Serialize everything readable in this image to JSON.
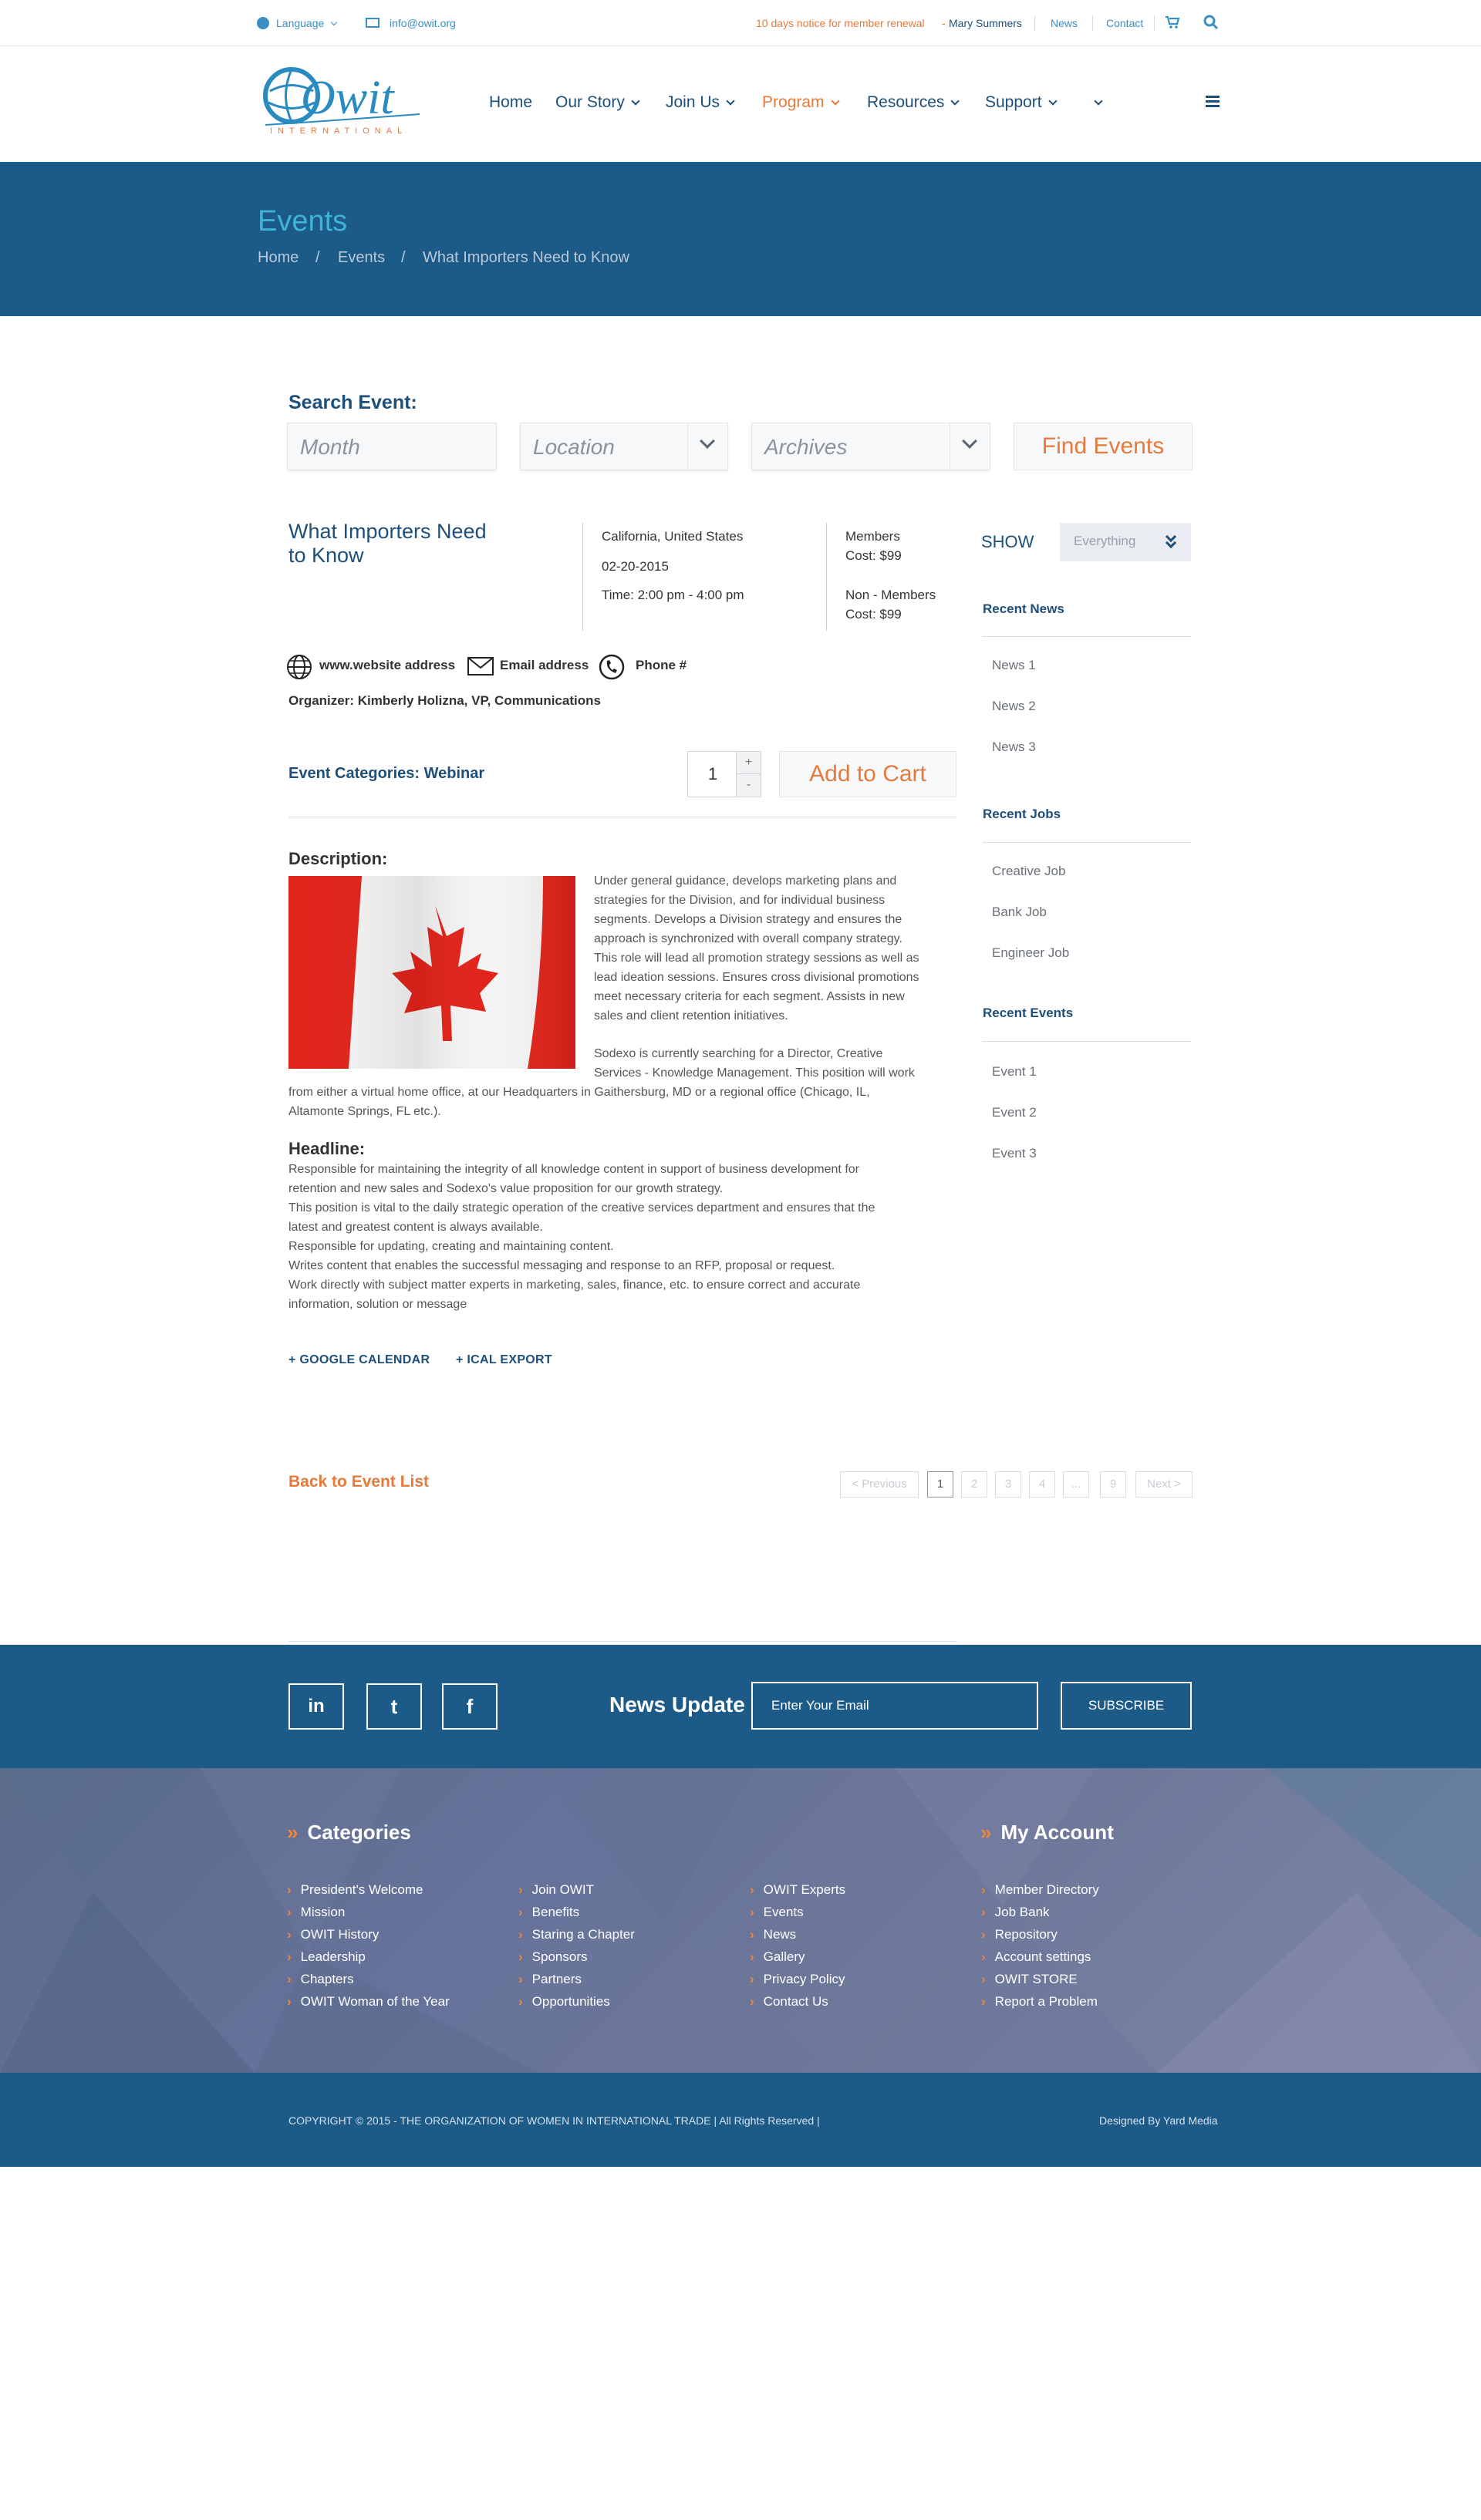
{
  "topbar": {
    "language": "Language",
    "email": "info@owit.org",
    "notice": "10 days notice for member renewal",
    "dash": "-",
    "user": "Mary Summers",
    "news": "News",
    "contact": "Contact"
  },
  "logo": {
    "word": "Owit",
    "sub": "INTERNATIONAL"
  },
  "nav": [
    {
      "label": "Home"
    },
    {
      "label": "Our Story"
    },
    {
      "label": "Join Us"
    },
    {
      "label": "Program"
    },
    {
      "label": "Resources"
    },
    {
      "label": "Support"
    }
  ],
  "banner": {
    "title": "Events",
    "crumbs": [
      "Home",
      "Events",
      "What Importers Need to Know"
    ],
    "sep": "/"
  },
  "search": {
    "title": "Search Event:",
    "month_placeholder": "Month",
    "location_placeholder": "Location",
    "archives_placeholder": "Archives",
    "button": "Find Events"
  },
  "event": {
    "title": "What Importers Need to Know",
    "location": "California, United States",
    "date": "02-20-2015",
    "time": "Time: 2:00 pm - 4:00 pm",
    "members_label": "Members",
    "members_cost": "Cost: $99",
    "nonmembers_label": "Non - Members",
    "nonmembers_cost": "Cost: $99",
    "website": "www.website address",
    "email": "Email address",
    "phone": "Phone #",
    "organizer": "Organizer: Kimberly Holizna, VP, Communications",
    "categories": "Event Categories: Webinar",
    "quantity": "1",
    "qty_up": "+",
    "qty_down": "-",
    "cart_button": "Add to Cart"
  },
  "description": {
    "heading": "Description:",
    "p1_lines": [
      "Under general guidance, develops marketing plans and",
      "strategies for the Division, and for individual business",
      "segments. Develops a Division strategy and ensures the",
      "approach is synchronized with overall company strategy.",
      "This role will lead all promotion strategy sessions as well as",
      "lead ideation sessions. Ensures cross divisional promotions",
      "meet necessary criteria for each segment. Assists in new",
      "sales and client retention initiatives."
    ],
    "p2_lines_right": [
      "Sodexo is currently searching for a Director, Creative",
      "Services - Knowledge Management. This position will work"
    ],
    "p2_lines_full": [
      "from either a virtual home office, at our Headquarters in Gaithersburg, MD or a regional office (Chicago, IL,",
      "Altamonte Springs, FL etc.)."
    ]
  },
  "headline": {
    "heading": "Headline:",
    "lines": [
      "Responsible for maintaining the integrity of all knowledge content in support of business development for",
      "retention and new sales and Sodexo's value proposition for our growth strategy.",
      "This position is vital to the daily strategic operation of the creative services department and ensures that the",
      "latest and greatest content is always available.",
      "Responsible for updating, creating and maintaining content.",
      "Writes content that enables the successful messaging and response to an RFP, proposal or request.",
      "Work directly with subject matter experts in marketing, sales, finance, etc. to ensure correct and accurate",
      "information, solution or message"
    ]
  },
  "links": {
    "google": "+ GOOGLE CALENDAR",
    "ical": "+ ICAL EXPORT",
    "back": "Back to Event List"
  },
  "pagination": {
    "prev": "< Previous",
    "pages": [
      "1",
      "2",
      "3",
      "4",
      "...",
      "9"
    ],
    "next": "Next >",
    "current_page": 1
  },
  "sidebar": {
    "show_label": "SHOW",
    "show_value": "Everything",
    "recent_news_title": "Recent News",
    "recent_news": [
      "News 1",
      "News 2",
      "News 3"
    ],
    "recent_jobs_title": "Recent Jobs",
    "recent_jobs": [
      "Creative Job",
      "Bank Job",
      "Engineer Job"
    ],
    "recent_events_title": "Recent Events",
    "recent_events": [
      "Event 1",
      "Event 2",
      "Event 3"
    ]
  },
  "newsletter": {
    "title": "News Update",
    "email_placeholder": "Enter Your Email",
    "button": "SUBSCRIBE",
    "social": [
      "in",
      "t",
      "f"
    ]
  },
  "footer": {
    "categories_title": "Categories",
    "account_title": "My Account",
    "col1": [
      "President's Welcome",
      "Mission",
      "OWIT History",
      "Leadership",
      "Chapters",
      "OWIT Woman of the Year"
    ],
    "col2": [
      "Join OWIT",
      "Benefits",
      "Staring a Chapter",
      "Sponsors",
      "Partners",
      "Opportunities"
    ],
    "col3": [
      "OWIT Experts",
      "Events",
      "News",
      "Gallery",
      "Privacy Policy",
      "Contact Us"
    ],
    "col4": [
      "Member Directory",
      "Job Bank",
      "Repository",
      "Account settings",
      "OWIT STORE",
      "Report a Problem"
    ]
  },
  "copyright": {
    "text": "COPYRIGHT © 2015 - THE ORGANIZATION OF WOMEN IN INTERNATIONAL TRADE  |  All Rights Reserved  |",
    "designed": "Designed By Yard Media"
  },
  "colors": {
    "brand_blue": "#1c5a88",
    "accent_orange": "#e47a3b",
    "title_cyan": "#3fb3d8"
  }
}
